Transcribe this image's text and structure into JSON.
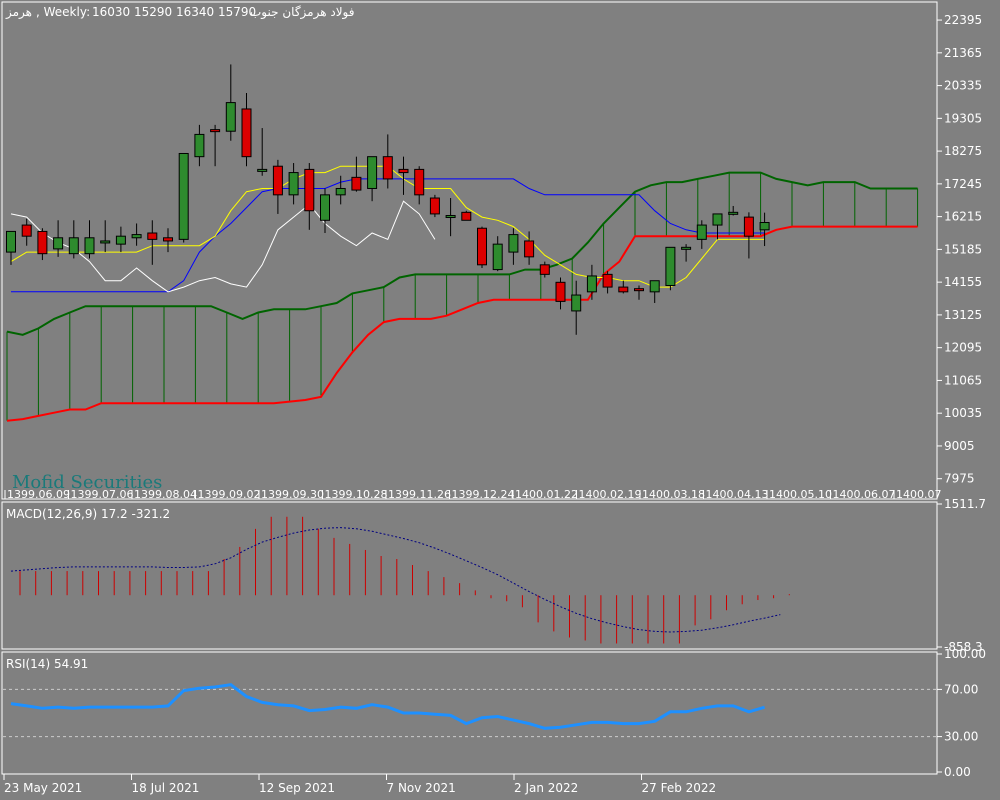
{
  "chart_header": {
    "symbol": "هرمز",
    "timeframe_text": ", Weekly:",
    "ohlc": "16030 15290 16340 15790",
    "name": "فولاد هرمزگان جنوب"
  },
  "watermark": "Mofid Securities",
  "colors": {
    "background": "#808080",
    "bull_candle": "#2e8b2e",
    "bear_candle": "#dd0000",
    "tenkan": "#ffff00",
    "kijun": "#0000ff",
    "chikou": "#ffffff",
    "senkou_a": "#006400",
    "senkou_b": "#ff0000",
    "cloud_hatch": "#006400",
    "macd_hist": "#cc0000",
    "macd_signal": "#000080",
    "rsi_line": "#1e90ff"
  },
  "chart_data": [
    {
      "type": "candlestick",
      "panel": "price",
      "indicator": "Ichimoku",
      "ylim": [
        7400,
        22900
      ],
      "y_ticks": [
        22395,
        21365,
        20335,
        19305,
        18275,
        17245,
        16215,
        15185,
        14155,
        13125,
        12095,
        11065,
        10035,
        9005,
        7975
      ],
      "x_labels": [
        "1399.06.09",
        "1399.07.06",
        "1399.08.04",
        "1399.09.02",
        "1399.09.30",
        "1399.10.28",
        "1399.11.26",
        "1399.12.24",
        "1400.01.22",
        "1400.02.19",
        "1400.03.18",
        "1400.04.13",
        "1400.05.10",
        "1400.06.07",
        "1400.07"
      ],
      "candles": [
        {
          "o": 15100,
          "h": 15650,
          "l": 14700,
          "c": 15750
        },
        {
          "o": 15950,
          "h": 16150,
          "l": 15300,
          "c": 15600
        },
        {
          "o": 15750,
          "h": 15850,
          "l": 14850,
          "c": 15050
        },
        {
          "o": 15200,
          "h": 16100,
          "l": 14950,
          "c": 15550
        },
        {
          "o": 15050,
          "h": 16100,
          "l": 14900,
          "c": 15550
        },
        {
          "o": 15050,
          "h": 16100,
          "l": 14900,
          "c": 15550
        },
        {
          "o": 15400,
          "h": 16100,
          "l": 15100,
          "c": 15450
        },
        {
          "o": 15350,
          "h": 15900,
          "l": 15100,
          "c": 15600
        },
        {
          "o": 15550,
          "h": 16000,
          "l": 15300,
          "c": 15650
        },
        {
          "o": 15700,
          "h": 16100,
          "l": 14700,
          "c": 15500
        },
        {
          "o": 15550,
          "h": 15850,
          "l": 15100,
          "c": 15450
        },
        {
          "o": 15500,
          "h": 18200,
          "l": 15400,
          "c": 18200
        },
        {
          "o": 18100,
          "h": 19100,
          "l": 17800,
          "c": 18800
        },
        {
          "o": 18950,
          "h": 19100,
          "l": 17800,
          "c": 18900
        },
        {
          "o": 18900,
          "h": 21000,
          "l": 18600,
          "c": 19800
        },
        {
          "o": 19600,
          "h": 20100,
          "l": 17800,
          "c": 18100
        },
        {
          "o": 17700,
          "h": 19000,
          "l": 17500,
          "c": 17700
        },
        {
          "o": 17800,
          "h": 18000,
          "l": 16300,
          "c": 16900
        },
        {
          "o": 16900,
          "h": 17900,
          "l": 16600,
          "c": 17600
        },
        {
          "o": 17700,
          "h": 17900,
          "l": 15800,
          "c": 16400
        },
        {
          "o": 16100,
          "h": 17100,
          "l": 15700,
          "c": 16900
        },
        {
          "o": 16900,
          "h": 17500,
          "l": 16600,
          "c": 17100
        },
        {
          "o": 17450,
          "h": 18100,
          "l": 17000,
          "c": 17050
        },
        {
          "o": 17100,
          "h": 18000,
          "l": 16700,
          "c": 18100
        },
        {
          "o": 18100,
          "h": 18800,
          "l": 17100,
          "c": 17400
        },
        {
          "o": 17700,
          "h": 18100,
          "l": 16900,
          "c": 17600
        },
        {
          "o": 17700,
          "h": 17800,
          "l": 16600,
          "c": 16900
        },
        {
          "o": 16800,
          "h": 16900,
          "l": 16200,
          "c": 16300
        },
        {
          "o": 16250,
          "h": 16800,
          "l": 15600,
          "c": 16250
        },
        {
          "o": 16350,
          "h": 16400,
          "l": 16100,
          "c": 16100
        },
        {
          "o": 15850,
          "h": 15900,
          "l": 14600,
          "c": 14700
        },
        {
          "o": 14550,
          "h": 15600,
          "l": 14500,
          "c": 15350
        },
        {
          "o": 15100,
          "h": 15850,
          "l": 14700,
          "c": 15650
        },
        {
          "o": 15450,
          "h": 15750,
          "l": 14700,
          "c": 14950
        },
        {
          "o": 14700,
          "h": 14800,
          "l": 14300,
          "c": 14400
        },
        {
          "o": 14150,
          "h": 14300,
          "l": 13300,
          "c": 13550
        },
        {
          "o": 13250,
          "h": 14200,
          "l": 12500,
          "c": 13750
        },
        {
          "o": 13850,
          "h": 14700,
          "l": 13600,
          "c": 14350
        },
        {
          "o": 14400,
          "h": 14500,
          "l": 13800,
          "c": 14000
        },
        {
          "o": 14000,
          "h": 14200,
          "l": 13800,
          "c": 13850
        },
        {
          "o": 13950,
          "h": 14050,
          "l": 13600,
          "c": 13900
        },
        {
          "o": 13850,
          "h": 14100,
          "l": 13500,
          "c": 14200
        },
        {
          "o": 14050,
          "h": 15100,
          "l": 13900,
          "c": 15250
        },
        {
          "o": 15200,
          "h": 15350,
          "l": 14800,
          "c": 15250
        },
        {
          "o": 15500,
          "h": 16100,
          "l": 15200,
          "c": 15950
        },
        {
          "o": 15950,
          "h": 16300,
          "l": 15500,
          "c": 16300
        },
        {
          "o": 16300,
          "h": 16550,
          "l": 16250,
          "c": 16350
        },
        {
          "o": 16200,
          "h": 16350,
          "l": 14900,
          "c": 15600
        },
        {
          "o": 15800,
          "h": 16340,
          "l": 15290,
          "c": 16030
        }
      ],
      "tenkan": [
        14800,
        15100,
        15100,
        15100,
        15100,
        15100,
        15100,
        15100,
        15100,
        15300,
        15300,
        15300,
        15300,
        15600,
        16400,
        17000,
        17100,
        17100,
        17400,
        17600,
        17600,
        17800,
        17800,
        17800,
        17800,
        17400,
        17100,
        17100,
        17100,
        16500,
        16200,
        16100,
        15900,
        15500,
        15000,
        14700,
        14400,
        14300,
        14300,
        14200,
        14200,
        14000,
        14000,
        14300,
        14900,
        15500,
        15500,
        15500,
        15500
      ],
      "kijun": [
        13850,
        13850,
        13850,
        13850,
        13850,
        13850,
        13850,
        13850,
        13850,
        13850,
        13850,
        14200,
        15100,
        15600,
        16000,
        16500,
        17000,
        17100,
        17100,
        17100,
        17100,
        17300,
        17400,
        17400,
        17400,
        17400,
        17400,
        17400,
        17400,
        17400,
        17400,
        17400,
        17400,
        17100,
        16900,
        16900,
        16900,
        16900,
        16900,
        16900,
        16900,
        16400,
        16000,
        15800,
        15700,
        15700,
        15700,
        15700,
        15700
      ],
      "chikou": [
        16300,
        16200,
        15700,
        15400,
        15200,
        14800,
        14200,
        14200,
        14600,
        14200,
        13850,
        14000,
        14200,
        14300,
        14100,
        14000,
        14700,
        15800,
        16200,
        16600,
        16000,
        15600,
        15300,
        15700,
        15500,
        16700,
        16300,
        15500
      ],
      "senkou_a": [
        12600,
        12500,
        12700,
        13000,
        13200,
        13400,
        13400,
        13400,
        13400,
        13400,
        13400,
        13400,
        13400,
        13400,
        13200,
        13000,
        13200,
        13300,
        13300,
        13300,
        13400,
        13500,
        13800,
        13900,
        14000,
        14300,
        14400,
        14400,
        14400,
        14400,
        14400,
        14400,
        14400,
        14550,
        14550,
        14700,
        14900,
        15400,
        16000,
        16500,
        17000,
        17200,
        17300,
        17300,
        17400,
        17500,
        17600,
        17600,
        17600,
        17400,
        17300,
        17200,
        17300,
        17300,
        17300,
        17100,
        17100,
        17100,
        17100
      ],
      "senkou_b": [
        9800,
        9850,
        9950,
        10050,
        10150,
        10150,
        10350,
        10350,
        10350,
        10350,
        10350,
        10350,
        10350,
        10350,
        10350,
        10350,
        10350,
        10350,
        10400,
        10450,
        10550,
        11300,
        11950,
        12500,
        12900,
        13000,
        13000,
        13000,
        13100,
        13300,
        13500,
        13600,
        13600,
        13600,
        13600,
        13600,
        13600,
        13600,
        14400,
        14800,
        15600,
        15600,
        15600,
        15600,
        15600,
        15600,
        15600,
        15600,
        15600,
        15800,
        15900,
        15900,
        15900,
        15900,
        15900,
        15900,
        15900,
        15900,
        15900
      ]
    },
    {
      "type": "bar",
      "panel": "macd",
      "title": "MACD(12,26,9) 17.2 -321.2",
      "ylim": [
        -858.3,
        1511.7
      ],
      "y_ticks": [
        1511.7,
        -858.3
      ],
      "histogram": [
        400,
        400,
        400,
        400,
        400,
        400,
        400,
        400,
        400,
        400,
        400,
        400,
        400,
        600,
        800,
        1100,
        1300,
        1300,
        1300,
        1100,
        950,
        850,
        750,
        650,
        600,
        500,
        400,
        300,
        200,
        80,
        -50,
        -100,
        -200,
        -450,
        -600,
        -700,
        -750,
        -800,
        -800,
        -800,
        -800,
        -800,
        -800,
        -500,
        -400,
        -250,
        -150,
        -80,
        -50,
        17.2
      ],
      "signal": [
        400,
        420,
        440,
        460,
        470,
        470,
        470,
        470,
        470,
        470,
        460,
        460,
        470,
        520,
        620,
        760,
        880,
        960,
        1030,
        1080,
        1110,
        1120,
        1100,
        1060,
        1000,
        940,
        870,
        780,
        680,
        570,
        460,
        340,
        200,
        60,
        -70,
        -190,
        -300,
        -390,
        -460,
        -520,
        -570,
        -600,
        -610,
        -600,
        -580,
        -540,
        -490,
        -430,
        -380,
        -321.2
      ]
    },
    {
      "type": "line",
      "panel": "rsi",
      "title": "RSI(14) 54.91",
      "ylim": [
        0,
        100
      ],
      "y_ticks": [
        "100.00",
        "70.00",
        "30.00",
        "0.00"
      ],
      "levels": [
        70,
        30
      ],
      "values": [
        58,
        56,
        54,
        55,
        54,
        55,
        55,
        55,
        55,
        55,
        56,
        69,
        71,
        72,
        74,
        64,
        59,
        57,
        56,
        52,
        53,
        55,
        54,
        57,
        55,
        50,
        50,
        49,
        48,
        41,
        46,
        47,
        44,
        41,
        37,
        38,
        40,
        42,
        42,
        41,
        41,
        43,
        51,
        51,
        54,
        56,
        56,
        51,
        54.91
      ]
    }
  ],
  "time_axis": [
    "23 May 2021",
    "18 Jul 2021",
    "12 Sep 2021",
    "7 Nov 2021",
    "2 Jan 2022",
    "27 Feb 2022"
  ]
}
